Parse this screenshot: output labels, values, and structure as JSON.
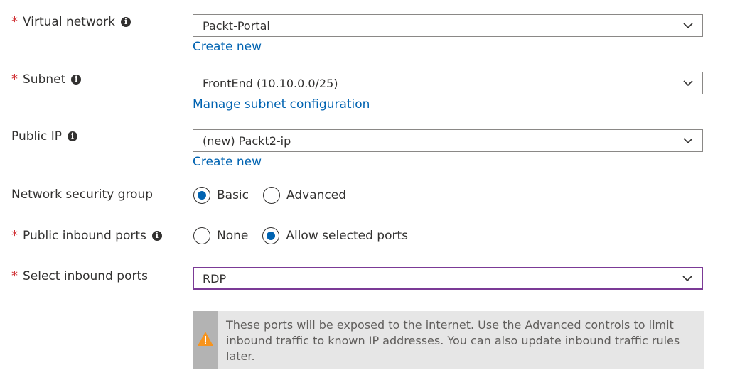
{
  "fields": {
    "virtual_network": {
      "label": "Virtual network",
      "required": "*",
      "value": "Packt-Portal",
      "link": "Create new"
    },
    "subnet": {
      "label": "Subnet",
      "required": "*",
      "value": "FrontEnd (10.10.0.0/25)",
      "link": "Manage subnet configuration"
    },
    "public_ip": {
      "label": "Public IP",
      "value": "(new) Packt2-ip",
      "link": "Create new"
    },
    "nsg": {
      "label": "Network security group",
      "options": [
        "Basic",
        "Advanced"
      ],
      "selected": "Basic"
    },
    "public_inbound_ports": {
      "label": "Public inbound ports",
      "required": "*",
      "options": [
        "None",
        "Allow selected ports"
      ],
      "selected": "Allow selected ports"
    },
    "select_inbound_ports": {
      "label": "Select inbound ports",
      "required": "*",
      "value": "RDP"
    }
  },
  "warning": {
    "icon": "warning-triangle-icon",
    "text": "These ports will be exposed to the internet. Use the Advanced controls to limit inbound traffic to known IP addresses. You can also update inbound traffic rules later."
  },
  "colors": {
    "required": "#d13438",
    "link": "#0063b1",
    "radio_checked": "#0063b1",
    "active_border": "#7b3a96",
    "warning_icon": "#f7941d"
  }
}
